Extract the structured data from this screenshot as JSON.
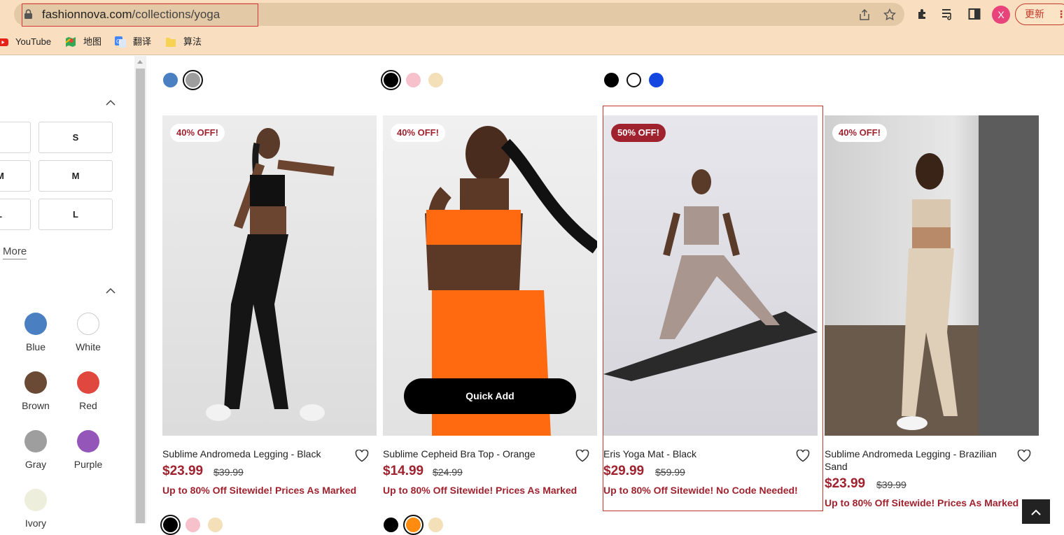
{
  "browser": {
    "url_domain": "fashionnova.com",
    "url_path": "/collections/yoga",
    "profile_initial": "X",
    "update_label": "更新",
    "update_menu": "⋮",
    "bookmarks": [
      "YouTube",
      "地图",
      "翻译",
      "算法"
    ]
  },
  "sidebar": {
    "sizes": [
      "S",
      "M",
      "L"
    ],
    "sizes_partial": [
      "M",
      "L"
    ],
    "more_label": "More",
    "colors": [
      {
        "name": "Blue",
        "hex": "#4a7fc1"
      },
      {
        "name": "White",
        "hex": "#ffffff"
      },
      {
        "name": "Brown",
        "hex": "#6b4a35"
      },
      {
        "name": "Red",
        "hex": "#e0473e"
      },
      {
        "name": "Gray",
        "hex": "#9e9e9e"
      },
      {
        "name": "Purple",
        "hex": "#9456b8"
      },
      {
        "name": "Ivory",
        "hex": "#eeeedd"
      }
    ]
  },
  "products": [
    {
      "name": "Sublime Andromeda Legging - Black",
      "badge": "40% OFF!",
      "price": "$23.99",
      "was": "$39.99",
      "promo": "Up to 80% Off Sitewide! Prices As Marked"
    },
    {
      "name": "Sublime Cepheid Bra Top - Orange",
      "badge": "40% OFF!",
      "price": "$14.99",
      "was": "$24.99",
      "promo": "Up to 80% Off Sitewide! Prices As Marked",
      "quick_add": "Quick Add"
    },
    {
      "name": "Eris Yoga Mat - Black",
      "badge": "50% OFF!",
      "price": "$29.99",
      "was": "$59.99",
      "promo": "Up to 80% Off Sitewide! No Code Needed!"
    },
    {
      "name": "Sublime Andromeda Legging - Brazilian Sand",
      "badge": "40% OFF!",
      "price": "$23.99",
      "was": "$39.99",
      "promo": "Up to 80% Off Sitewide! Prices As Marked"
    }
  ],
  "swatches_top": [
    [
      "#4a7fc1",
      "#9e9e9e"
    ],
    [
      "#000000",
      "#f7c1cc",
      "#f3dfb8"
    ],
    [
      "#000000",
      "#ffffff",
      "#1446e0"
    ]
  ],
  "colors": {
    "accent": "#a0222e",
    "chrome": "#f9dfc0"
  }
}
